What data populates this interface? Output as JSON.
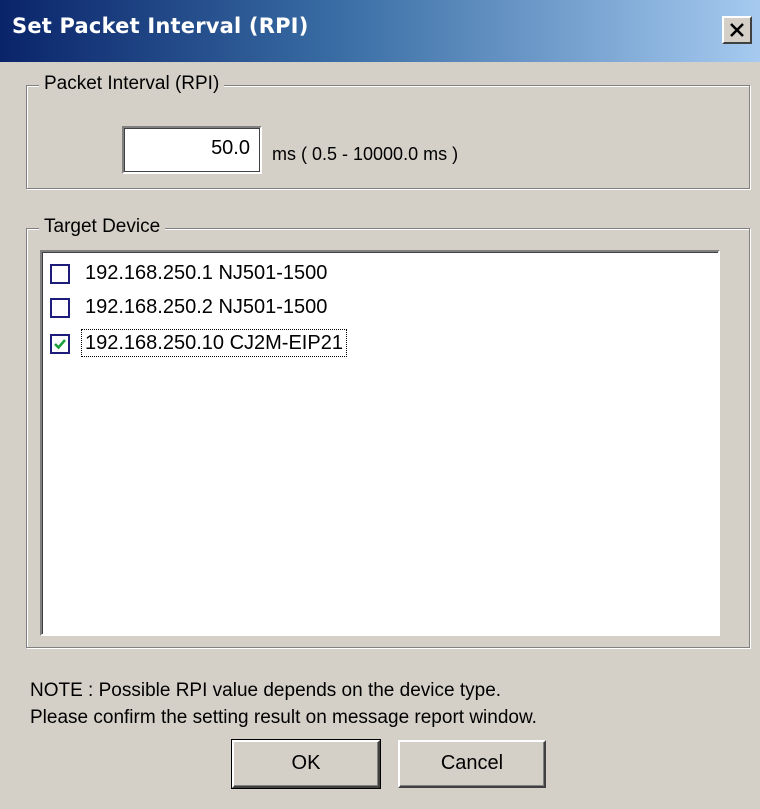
{
  "window": {
    "title": "Set Packet Interval (RPI)"
  },
  "rpi_group": {
    "legend": "Packet Interval (RPI)",
    "value": "50.0",
    "range_text": "ms ( 0.5 - 10000.0 ms )"
  },
  "target_group": {
    "legend": "Target Device",
    "devices": [
      {
        "label": "192.168.250.1 NJ501-1500",
        "checked": false
      },
      {
        "label": "192.168.250.2 NJ501-1500",
        "checked": false
      },
      {
        "label": "192.168.250.10 CJ2M-EIP21",
        "checked": true
      }
    ]
  },
  "note": {
    "line1": "NOTE : Possible RPI value depends on the device type.",
    "line2": "Please confirm the setting result on message report window."
  },
  "buttons": {
    "ok": "OK",
    "cancel": "Cancel"
  },
  "icons": {
    "close": "close-icon",
    "check": "checkmark-icon"
  },
  "colors": {
    "title_start": "#0a246a",
    "title_end": "#a6caf0",
    "check": "#1e9e3a"
  }
}
